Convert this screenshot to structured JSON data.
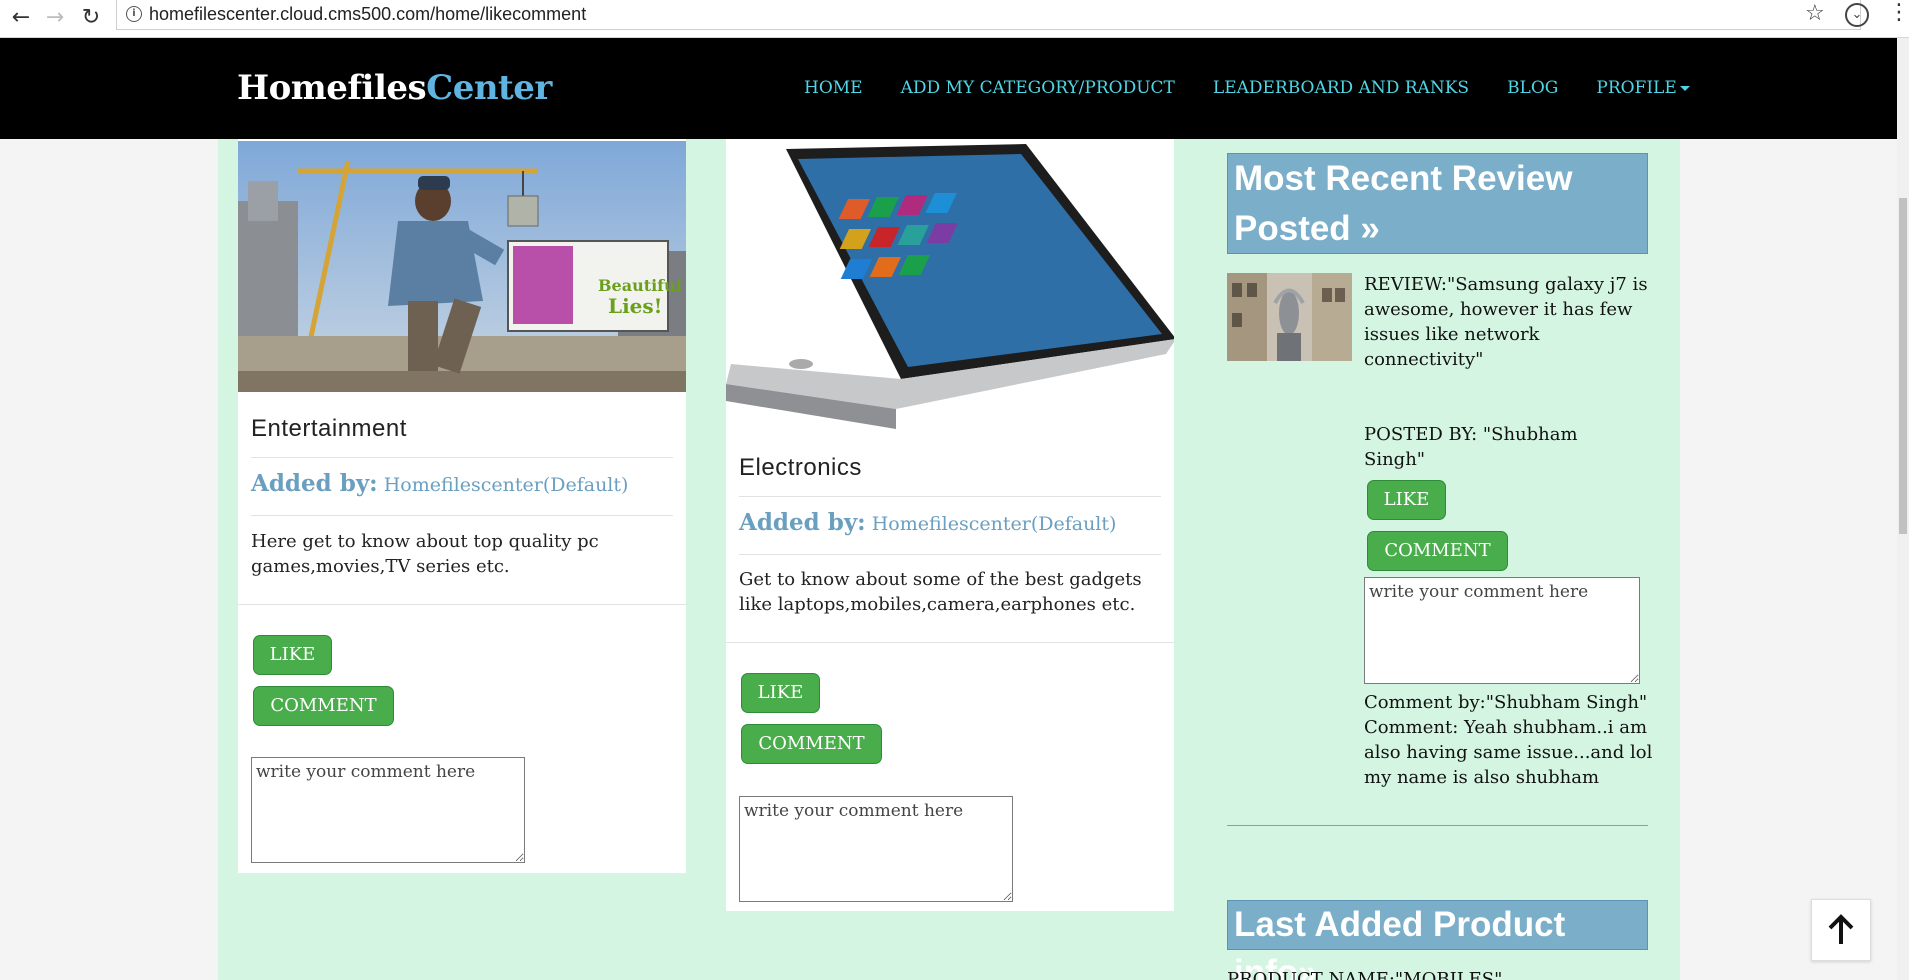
{
  "browser": {
    "url": "homefilescenter.cloud.cms500.com/home/likecomment",
    "back_glyph": "←",
    "forward_glyph": "→",
    "reload_glyph": "↻",
    "info_glyph": "i",
    "star_glyph": "☆",
    "ext_glyph": "⌄",
    "menu_glyph": "⋮"
  },
  "site": {
    "brand_primary": "Homefiles",
    "brand_accent": "Center",
    "colors": {
      "nav_bg": "#000000",
      "nav_link": "#4fd6e6",
      "content_bg": "#d4f5e2",
      "button_green": "#4aad4b",
      "header_blue": "#7aaec9",
      "added_by": "#6a9fc0"
    }
  },
  "nav": {
    "items": [
      "HOME",
      "ADD MY CATEGORY/PRODUCT",
      "LEADERBOARD AND RANKS",
      "BLOG",
      "PROFILE"
    ]
  },
  "cards": [
    {
      "title": "Entertainment",
      "added_by_label": "Added by:",
      "added_by_value": "Homefilescenter(Default)",
      "description": "Here get to know about top quality pc games,movies,TV series etc.",
      "like_label": "LIKE",
      "comment_label": "COMMENT",
      "comment_placeholder": "write your comment here",
      "image_alt": "game-scene"
    },
    {
      "title": "Electronics",
      "added_by_label": "Added by:",
      "added_by_value": "Homefilescenter(Default)",
      "description": "Get to know about some of the best gadgets like laptops,mobiles,camera,earphones etc.",
      "like_label": "LIKE",
      "comment_label": "COMMENT",
      "comment_placeholder": "write your comment here",
      "image_alt": "laptop"
    }
  ],
  "sidebar": {
    "recent_review_title": "Most Recent Review Posted »",
    "review_text": "REVIEW:\"Samsung galaxy j7 is awesome, however it has few issues like network connectivity\"",
    "posted_by": "POSTED BY: \"Shubham Singh\"",
    "like_label": "LIKE",
    "comment_label": "COMMENT",
    "comment_placeholder": "write your comment here",
    "comment_by": "Comment by:\"Shubham Singh\"",
    "comment_text": "Comment: Yeah shubham..i am also having same issue...and lol my name is also shubham",
    "last_product_title": "Last Added Product info»",
    "product_name": "PRODUCT NAME:\"MOBILES\""
  },
  "back_to_top_icon": "arrow-up-icon"
}
